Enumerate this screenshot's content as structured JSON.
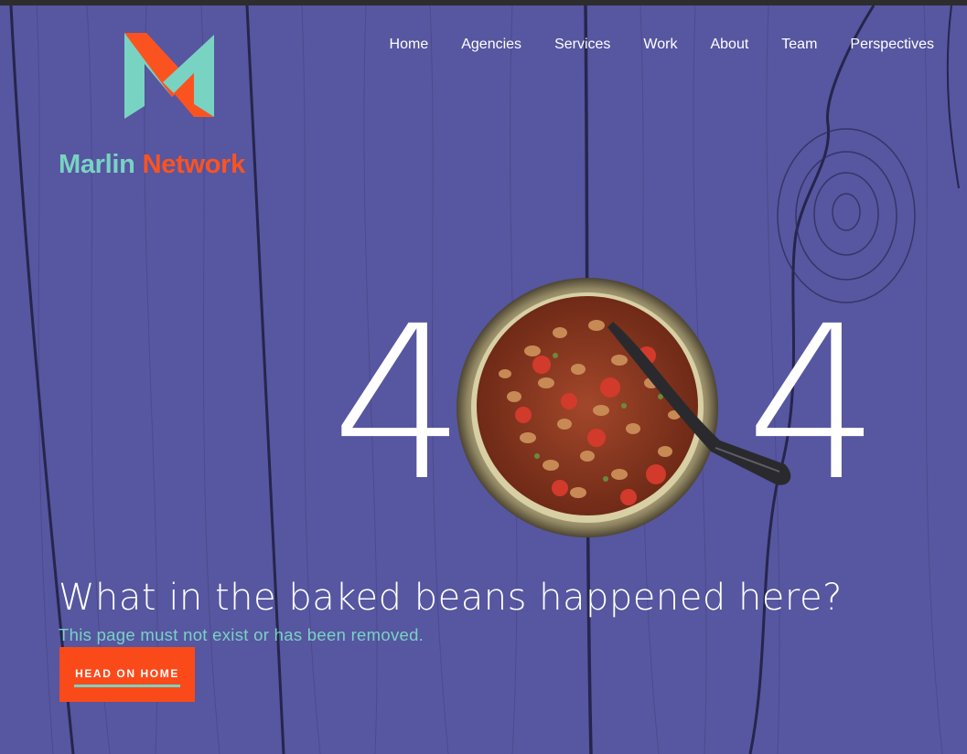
{
  "brand": {
    "word1": "Marlin",
    "word2": "Network",
    "primary_color": "#fb5320",
    "secondary_color": "#78d3c3",
    "icon": "m-logo-icon"
  },
  "nav": {
    "items": [
      {
        "label": "Home"
      },
      {
        "label": "Agencies"
      },
      {
        "label": "Services"
      },
      {
        "label": "Work"
      },
      {
        "label": "About"
      },
      {
        "label": "Team"
      },
      {
        "label": "Perspectives"
      }
    ]
  },
  "error": {
    "digit_left": "4",
    "digit_right": "4",
    "image": "baked-beans-bowl-icon",
    "headline": "What in the baked beans happened here?",
    "message": "This page must not exist or has been removed."
  },
  "cta": {
    "label": "HEAD ON HOME",
    "color": "#fb4a1a"
  },
  "background": {
    "color": "#5756a0",
    "texture": "wood-planks"
  }
}
